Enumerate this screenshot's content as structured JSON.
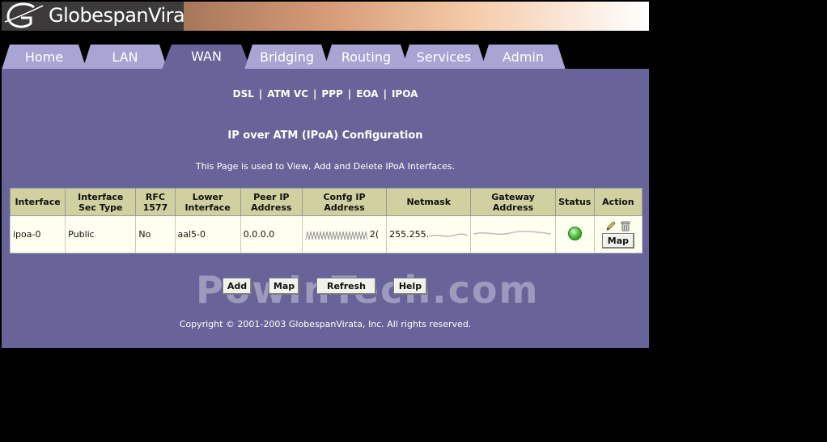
{
  "brand": {
    "name": "GlobespanVirata"
  },
  "tabs": [
    {
      "label": "Home"
    },
    {
      "label": "LAN"
    },
    {
      "label": "WAN",
      "active": true
    },
    {
      "label": "Bridging"
    },
    {
      "label": "Routing"
    },
    {
      "label": "Services"
    },
    {
      "label": "Admin"
    }
  ],
  "subnav": [
    "DSL",
    "ATM VC",
    "PPP",
    "EOA",
    "IPOA"
  ],
  "page": {
    "title": "IP over ATM (IPoA) Configuration",
    "description": "This Page is used to View, Add and Delete IPoA Interfaces."
  },
  "table": {
    "headers": {
      "interface": "Interface",
      "sec_type_1": "Interface",
      "sec_type_2": "Sec Type",
      "rfc_1": "RFC",
      "rfc_2": "1577",
      "lower_1": "Lower",
      "lower_2": "Interface",
      "peer_1": "Peer IP",
      "peer_2": "Address",
      "confg_1": "Confg IP",
      "confg_2": "Address",
      "netmask": "Netmask",
      "gateway_1": "Gateway",
      "gateway_2": "Address",
      "status": "Status",
      "action": "Action"
    },
    "rows": [
      {
        "interface": "ipoa-0",
        "sec_type": "Public",
        "rfc1577": "No",
        "lower_interface": "aal5-0",
        "peer_ip": "0.0.0.0",
        "confg_ip_tail": "2(",
        "netmask": "255.255.",
        "status": "up",
        "map_label": "Map"
      }
    ]
  },
  "buttons": {
    "add": "Add",
    "map": "Map",
    "refresh": "Refresh",
    "help": "Help"
  },
  "copyright": "Copyright © 2001-2003 GlobespanVirata, Inc. All rights reserved.",
  "watermark": "PowInTech.com",
  "colors": {
    "panel": "#68649a",
    "tab": "#a8a4d4",
    "header_cell": "#d0d0a0",
    "row_cell": "#fffff0"
  }
}
